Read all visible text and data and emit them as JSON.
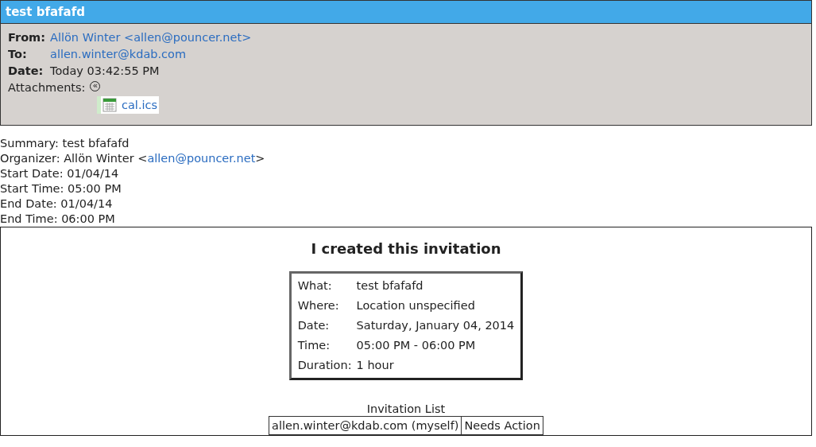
{
  "header": {
    "title": "test bfafafd",
    "fields": [
      {
        "label": "From:",
        "value": "Allön Winter <allen@pouncer.net>",
        "kind": "link"
      },
      {
        "label": "To:",
        "value": "allen.winter@kdab.com",
        "kind": "link"
      },
      {
        "label": "Date:",
        "value": "Today 03:42:55 PM",
        "kind": "text"
      }
    ],
    "attachments_label": "Attachments:",
    "toggle": "«",
    "attachments": [
      {
        "name": "cal.ics"
      }
    ]
  },
  "summary": [
    "Summary: test bfafafd"
  ],
  "organizer": {
    "prefix": "Organizer: Allön Winter <",
    "link": "allen@pouncer.net",
    "suffix": ">"
  },
  "details": [
    "Start Date: 01/04/14",
    "Start Time: 05:00 PM",
    "End Date: 01/04/14",
    "End Time: 06:00 PM"
  ],
  "invitation": {
    "title": "I created this invitation",
    "rows": [
      {
        "label": "What:",
        "value": "test bfafafd"
      },
      {
        "label": "Where:",
        "value": "Location unspecified"
      },
      {
        "label": "Date:",
        "value": "Saturday, January 04, 2014"
      },
      {
        "label": "Time:",
        "value": "05:00 PM - 06:00 PM"
      },
      {
        "label": "Duration:",
        "value": "1 hour"
      }
    ],
    "list_title": "Invitation List",
    "attendees": [
      {
        "email": "allen.winter@kdab.com (myself)",
        "status": "Needs Action"
      }
    ]
  }
}
